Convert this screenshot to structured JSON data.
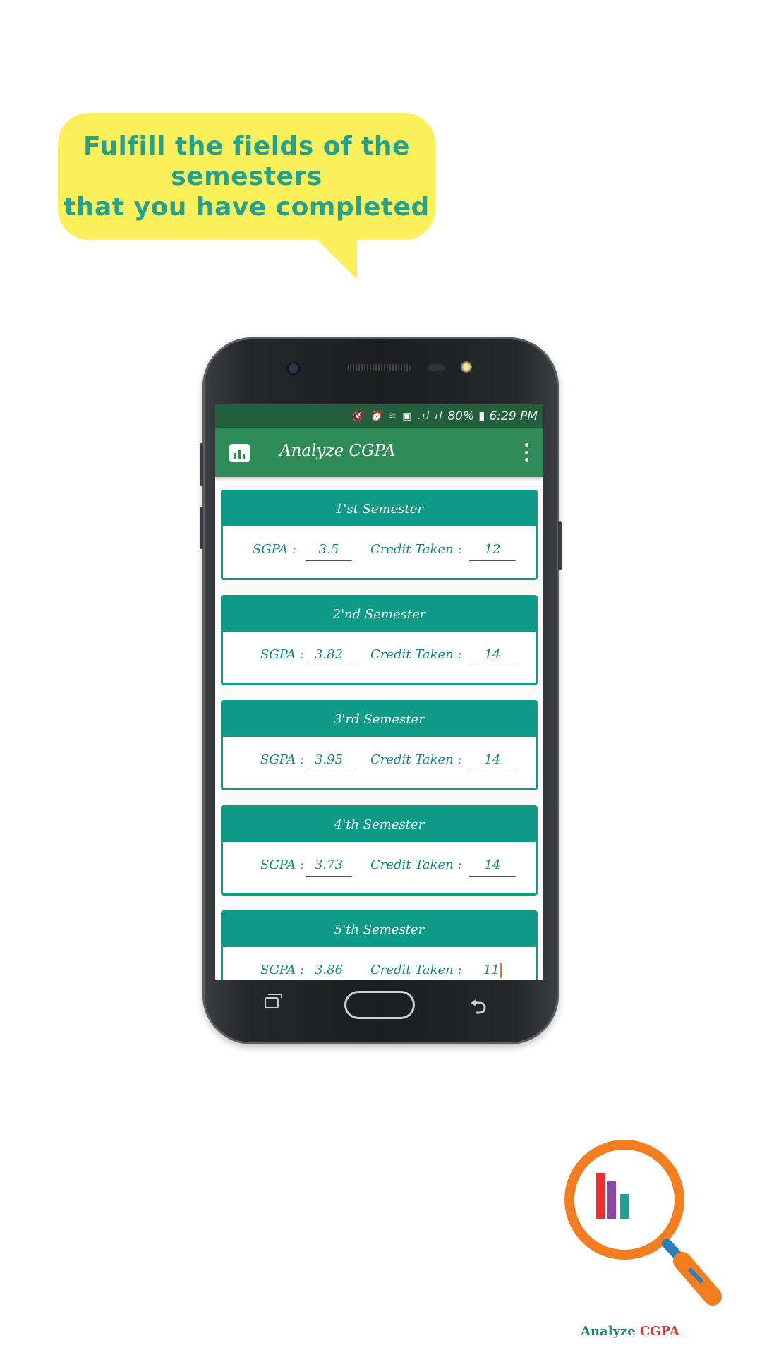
{
  "bubble": {
    "text": "Fulfill the fields of the\nsemesters\nthat you have completed"
  },
  "status_bar": {
    "icons_text": "↓⏰⨾† .∥",
    "battery": "80%",
    "time": "6:29 PM"
  },
  "app_bar": {
    "title": "Analyze CGPA"
  },
  "semesters": [
    {
      "title": "1'st Semester",
      "sgpa_label": "SGPA :",
      "sgpa": "3.5",
      "credit_label": "Credit Taken :",
      "credit": "12"
    },
    {
      "title": "2'nd Semester",
      "sgpa_label": "SGPA :",
      "sgpa": "3.82",
      "credit_label": "Credit Taken :",
      "credit": "14"
    },
    {
      "title": "3'rd Semester",
      "sgpa_label": "SGPA :",
      "sgpa": "3.95",
      "credit_label": "Credit Taken :",
      "credit": "14"
    },
    {
      "title": "4'th Semester",
      "sgpa_label": "SGPA :",
      "sgpa": "3.73",
      "credit_label": "Credit Taken :",
      "credit": "14"
    },
    {
      "title": "5'th Semester",
      "sgpa_label": "SGPA :",
      "sgpa": "3.86",
      "credit_label": "Credit Taken :",
      "credit": "11"
    }
  ],
  "logo": {
    "text_part1": "Analyze",
    "text_part2": "CGPA",
    "color1": "#1f8a70",
    "color2": "#e8312f"
  },
  "colors": {
    "statusbar": "#22603d",
    "appbar": "#2e8b57",
    "card_accent": "#0d9a86",
    "bubble": "#fcf05a",
    "bubble_text": "#23a191"
  }
}
